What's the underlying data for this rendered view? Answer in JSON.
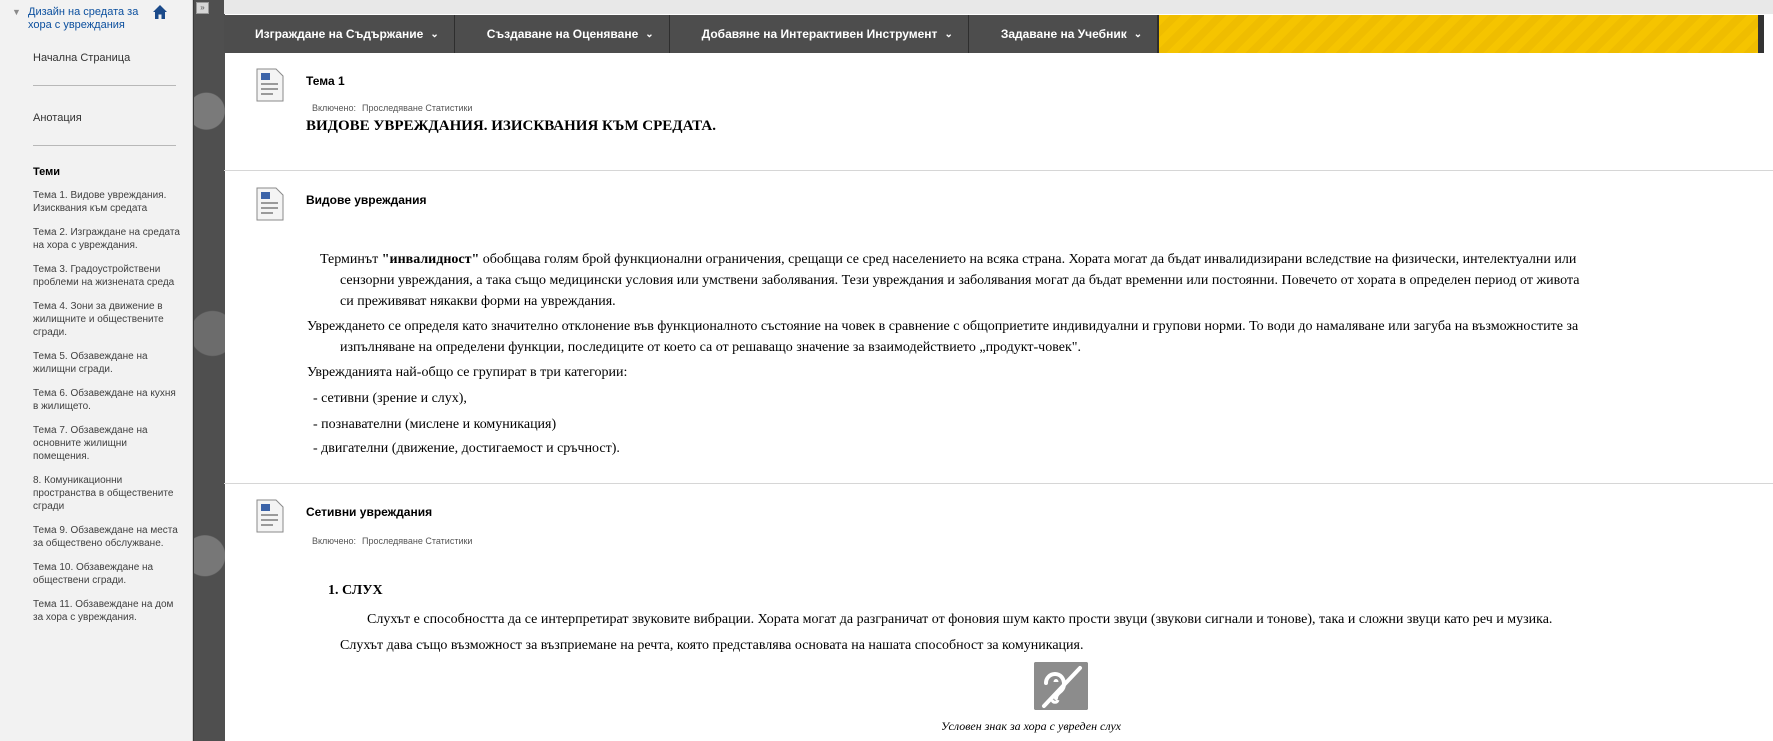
{
  "sidebar": {
    "course_title": "Дизайн на средата за хора с увреждания",
    "home_link": "Начална Страница",
    "annotation_link": "Анотация",
    "topics_heading": "Теми",
    "topics": [
      "Тема 1. Видове увреждания. Изисквания към средата",
      "Тема 2. Изграждане на средата на хора с увреждания.",
      "Тема 3. Градоустройствени проблеми на жизнената среда",
      "Тема 4. Зони за движение в жилищните и обществените сгради.",
      "Тема 5. Обзавеждане на жилищни сгради.",
      "Тема 6. Обзавеждане на кухня в жилището.",
      "Тема 7. Обзавеждане на основните жилищни помещения.",
      "8. Комуникационни пространства в обществените сгради",
      "Тема 9. Обзавеждане на места за обществено обслужване.",
      "Тема 10. Обзавеждане на обществени сгради.",
      "Тема 11. Обзавеждане на дом за хора с увреждания."
    ]
  },
  "actionbar": {
    "items": [
      "Изграждане на Съдържание",
      "Създаване на Оценяване",
      "Добавяне на Интерактивен Инструмент",
      "Задаване на Учебник"
    ]
  },
  "items": {
    "topic1": {
      "title": "Тема 1",
      "meta_enabled": "Включено:",
      "meta_tracking": "Проследяване Статистики",
      "heading": "ВИДОВЕ УВРЕЖДАНИЯ. ИЗИСКВАНИЯ КЪМ СРЕДАТА."
    },
    "types": {
      "title": "Видове увреждания",
      "p1_pre": "Терминът ",
      "p1_bold": "\"инвалидност\"",
      "p1_l1": " обобщава голям брой функционални ограничения, срещащи се сред населението на всяка страна. Хората могат да бъдат инвалидизирани вследствие на физически, интелектуални или",
      "p1_l2": "сензорни увреждания, а така също медицински условия или умствени заболявания. Тези увреждания и заболявания могат да бъдат временни или постоянни. Повечето от хората в определен период от живота",
      "p1_l3": "си преживяват някакви форми на увреждания.",
      "p2_l1": "Увреждането се определя като значително отклонение във функционалното състояние на човек в сравнение с общоприетите индивидуални и групови норми. То води до намаляване или загуба на възможностите за",
      "p2_l2": "изпълняване на определени функции, последиците от което са от решаващо значение за взаимодействието „продукт-човек\".",
      "p3": "Уврежданията най-общо се групират в три категории:",
      "li1": "-  сетивни (зрение и слух),",
      "li2": "- познавателни (мислене и комуникация)",
      "li3": "- двигателни (движение, достигаемост и сръчност)."
    },
    "sensory": {
      "title": "Сетивни увреждания",
      "meta_enabled": "Включено:",
      "meta_tracking": "Проследяване Статистики",
      "heading": "1. СЛУХ",
      "p1": "Слухът е способността да се интерпретират звуковите вибрации. Хората могат да разграничат от фоновия шум както прости звуци (звукови сигнали и тонове), така и сложни звуци като реч и музика.",
      "p2": "Слухът дава също възможност за възприемане на речта, която представлява основата на нашата способност за комуникация.",
      "caption": "Условен знак за хора с увреден слух"
    }
  },
  "colors": {
    "actionbar": "#4d4d4d",
    "hazard": "#f5c400",
    "sidebar_bg": "#f2f2f2",
    "link": "#0b4f9e"
  },
  "icons": {
    "home": "home-icon",
    "document": "document-icon",
    "chevron": "chevron-down-icon",
    "hearing": "hearing-impaired-icon"
  }
}
